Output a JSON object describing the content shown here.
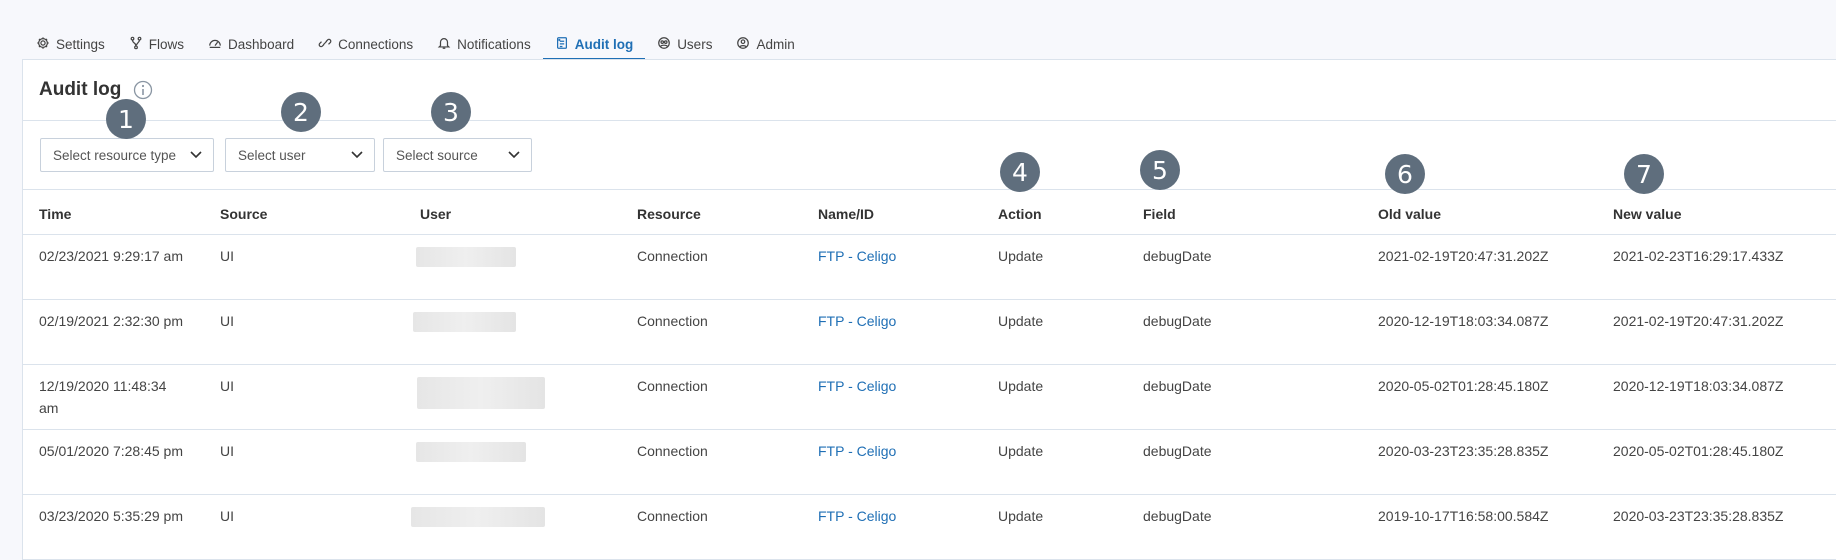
{
  "tabs": [
    {
      "label": "Settings",
      "icon": "gear-icon"
    },
    {
      "label": "Flows",
      "icon": "flow-icon"
    },
    {
      "label": "Dashboard",
      "icon": "dashboard-icon"
    },
    {
      "label": "Connections",
      "icon": "link-icon"
    },
    {
      "label": "Notifications",
      "icon": "bell-icon"
    },
    {
      "label": "Audit log",
      "icon": "audit-log-icon",
      "active": true
    },
    {
      "label": "Users",
      "icon": "users-icon"
    },
    {
      "label": "Admin",
      "icon": "admin-icon"
    }
  ],
  "page": {
    "title": "Audit log"
  },
  "filters": {
    "resource_type": "Select resource type",
    "user": "Select user",
    "source": "Select source"
  },
  "table": {
    "headers": [
      "Time",
      "Source",
      "User",
      "Resource",
      "Name/ID",
      "Action",
      "Field",
      "Old value",
      "New value"
    ],
    "rows": [
      {
        "time": "02/23/2021 9:29:17 am",
        "source": "UI",
        "resource": "Connection",
        "name": "FTP - Celigo",
        "action": "Update",
        "field": "debugDate",
        "old": "2021-02-19T20:47:31.202Z",
        "new": "2021-02-23T16:29:17.433Z"
      },
      {
        "time": "02/19/2021 2:32:30 pm",
        "source": "UI",
        "resource": "Connection",
        "name": "FTP - Celigo",
        "action": "Update",
        "field": "debugDate",
        "old": "2020-12-19T18:03:34.087Z",
        "new": "2021-02-19T20:47:31.202Z"
      },
      {
        "time": "12/19/2020 11:48:34 am",
        "source": "UI",
        "resource": "Connection",
        "name": "FTP - Celigo",
        "action": "Update",
        "field": "debugDate",
        "old": "2020-05-02T01:28:45.180Z",
        "new": "2020-12-19T18:03:34.087Z"
      },
      {
        "time": "05/01/2020 7:28:45 pm",
        "source": "UI",
        "resource": "Connection",
        "name": "FTP - Celigo",
        "action": "Update",
        "field": "debugDate",
        "old": "2020-03-23T23:35:28.835Z",
        "new": "2020-05-02T01:28:45.180Z"
      },
      {
        "time": "03/23/2020 5:35:29 pm",
        "source": "UI",
        "resource": "Connection",
        "name": "FTP - Celigo",
        "action": "Update",
        "field": "debugDate",
        "old": "2019-10-17T16:58:00.584Z",
        "new": "2020-03-23T23:35:28.835Z"
      }
    ]
  },
  "callouts": [
    "1",
    "2",
    "3",
    "4",
    "5",
    "6",
    "7"
  ],
  "colors": {
    "accent": "#1f6fb5",
    "callout": "#5f6e7d"
  }
}
